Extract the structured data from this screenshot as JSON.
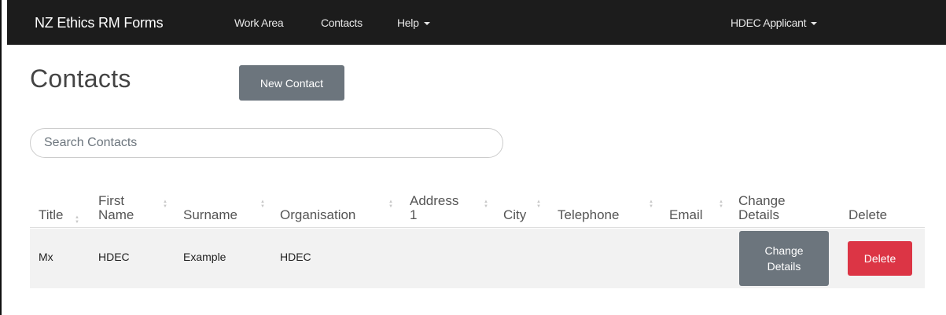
{
  "navbar": {
    "brand": "NZ Ethics RM Forms",
    "links": [
      "Work Area",
      "Contacts",
      "Help"
    ],
    "user_menu": "HDEC Applicant"
  },
  "page": {
    "title": "Contacts",
    "new_button": "New Contact",
    "search_placeholder": "Search Contacts"
  },
  "table": {
    "headers": [
      "Title",
      "First\nName",
      "Surname",
      "Organisation",
      "Address\n1",
      "City",
      "Telephone",
      "Email",
      "Change\nDetails",
      "Delete"
    ],
    "rows": [
      {
        "title": "Mx",
        "first_name": "HDEC",
        "surname": "Example",
        "organisation": "HDEC",
        "address1": "",
        "city": "",
        "telephone": "",
        "email": "",
        "change_label": "Change Details",
        "delete_label": "Delete"
      }
    ]
  },
  "colors": {
    "navbar_bg": "#1c1c1c",
    "secondary": "#6c757d",
    "danger": "#dc3545",
    "row_bg": "#f2f2f2"
  }
}
